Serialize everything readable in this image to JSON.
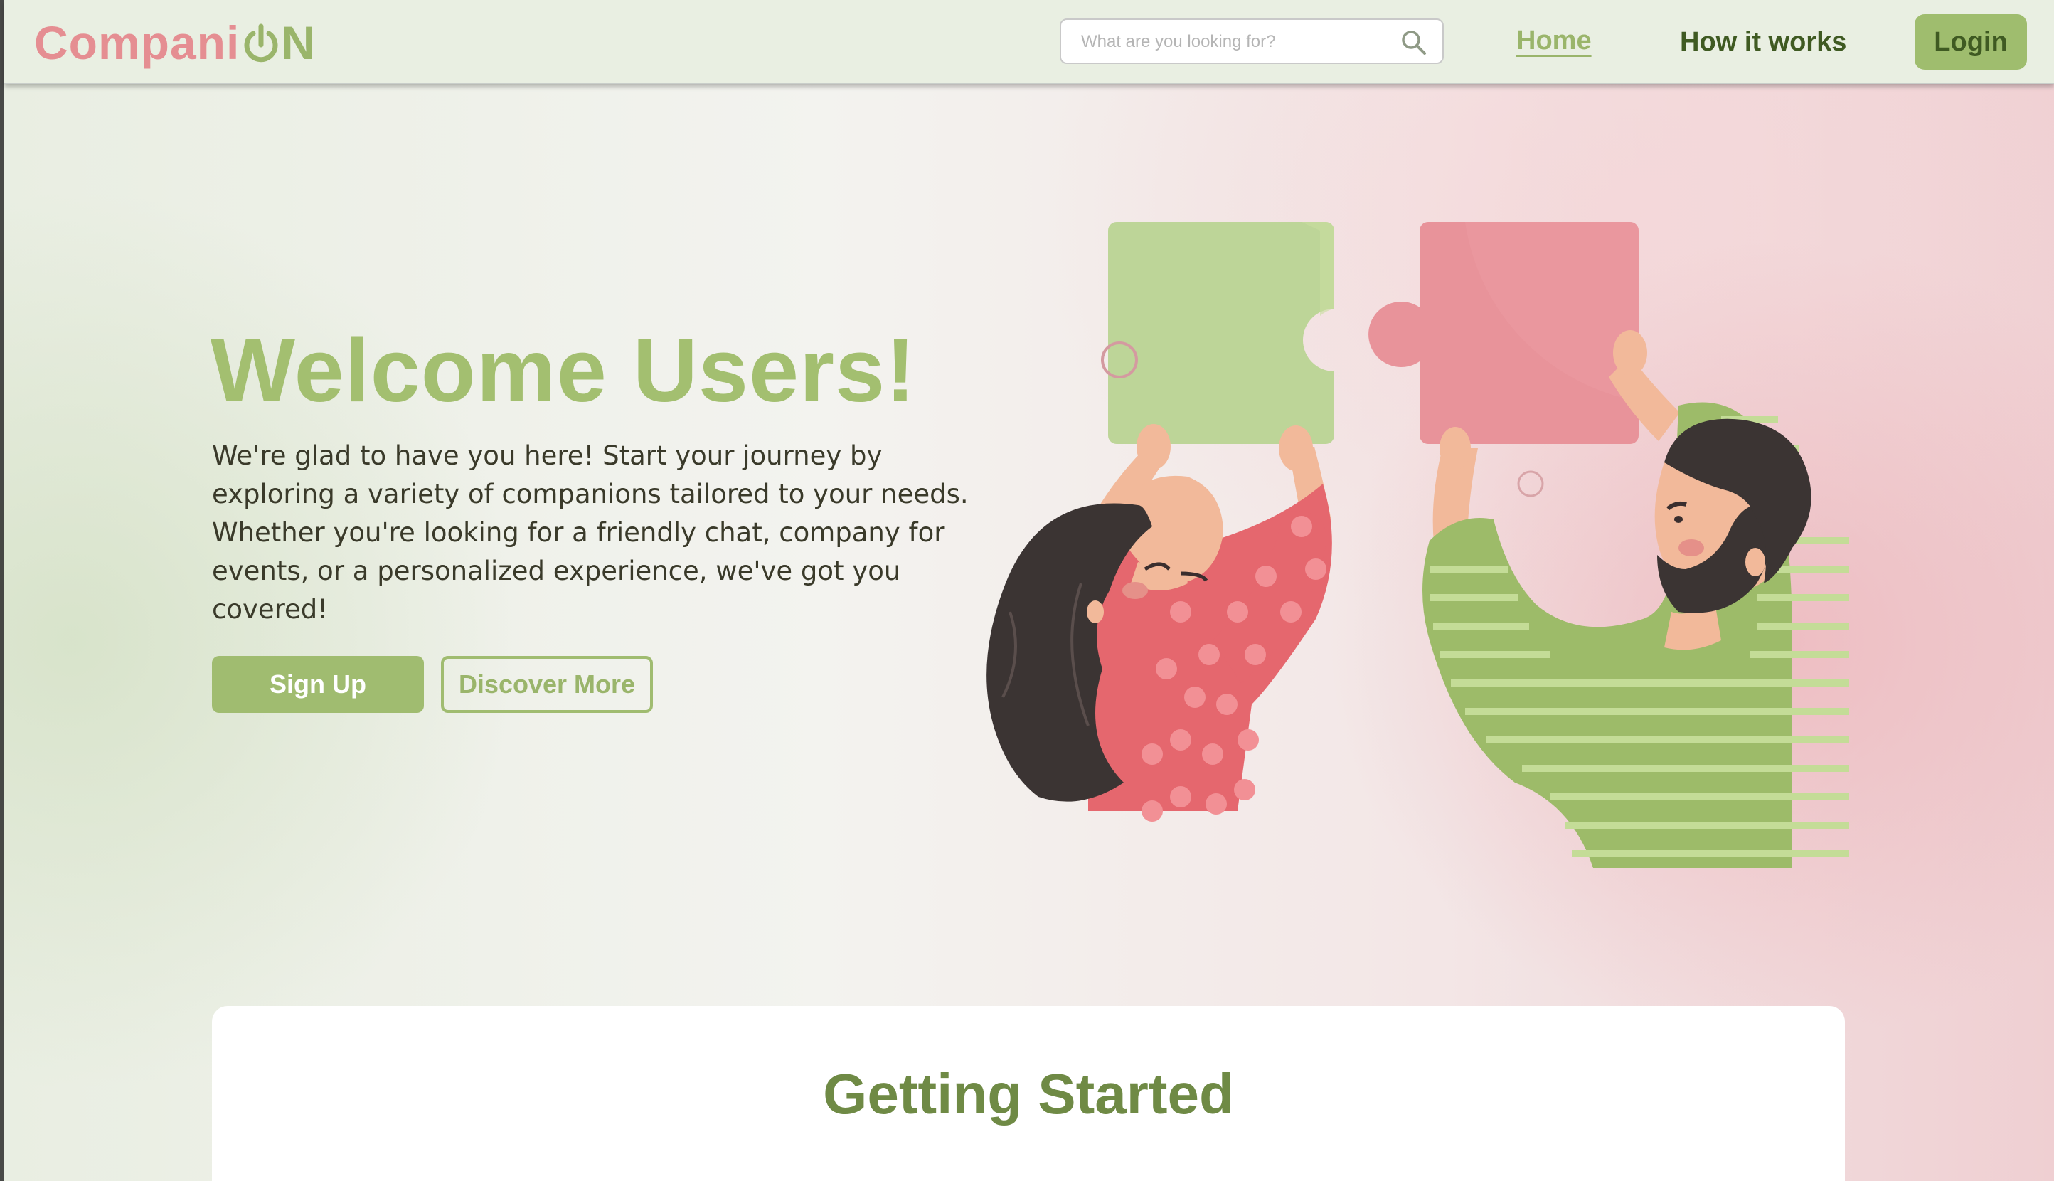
{
  "header": {
    "logo": {
      "part1": "Compani",
      "part2": "N"
    },
    "search": {
      "placeholder": "What are you looking for?"
    },
    "nav": {
      "home": "Home",
      "how_it_works": "How it works"
    },
    "login_label": "Login"
  },
  "hero": {
    "title": "Welcome Users!",
    "text": "We're glad to have you here! Start your journey by exploring a variety of companions tailored to your needs. Whether you're looking for a friendly chat, company for events, or a personalized experience, we've got you covered!",
    "signup_label": "Sign Up",
    "discover_label": "Discover More"
  },
  "getting_started": {
    "title": "Getting Started"
  },
  "colors": {
    "brand_green": "#a0bc70",
    "dark_green": "#3f5a22",
    "brand_pink": "#e58e92"
  },
  "icons": [
    "power-icon",
    "search-icon"
  ]
}
